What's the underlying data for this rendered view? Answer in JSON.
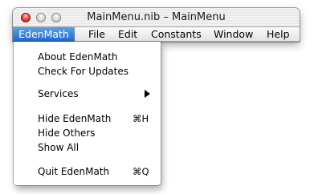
{
  "window": {
    "title": "MainMenu.nib – MainMenu"
  },
  "menubar": {
    "items": [
      {
        "label": "EdenMath"
      },
      {
        "label": "File"
      },
      {
        "label": "Edit"
      },
      {
        "label": "Constants"
      },
      {
        "label": "Window"
      },
      {
        "label": "Help"
      }
    ]
  },
  "dropdown": {
    "items": [
      {
        "label": "About EdenMath"
      },
      {
        "label": "Check For Updates"
      },
      {
        "label": "Services"
      },
      {
        "label": "Hide EdenMath",
        "shortcut": "⌘H"
      },
      {
        "label": "Hide Others"
      },
      {
        "label": "Show All"
      },
      {
        "label": "Quit EdenMath",
        "shortcut": "⌘Q"
      }
    ]
  },
  "colors": {
    "selection": "#2f78d6",
    "close_button": "#ec4b3e"
  },
  "icons": [
    "close-button-icon",
    "minimize-button-icon",
    "zoom-button-icon",
    "submenu-arrow-icon"
  ]
}
